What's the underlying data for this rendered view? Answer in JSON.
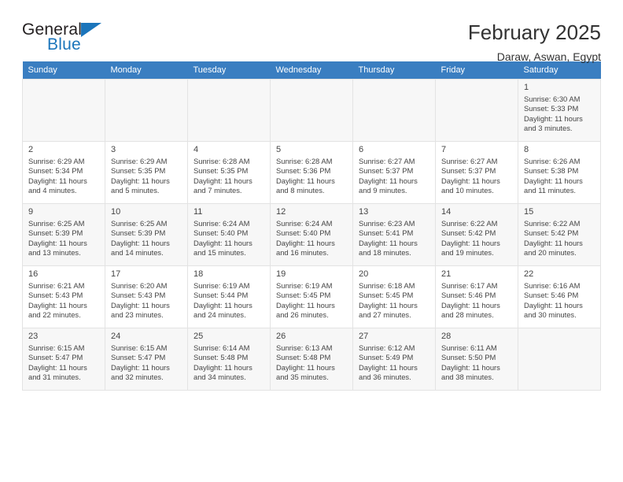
{
  "brand": {
    "name_top": "General",
    "name_bottom": "Blue",
    "accent_color": "#1b75bb"
  },
  "header": {
    "title": "February 2025",
    "subtitle": "Daraw, Aswan, Egypt"
  },
  "calendar": {
    "header_bg": "#3a7ec1",
    "weekdays": [
      "Sunday",
      "Monday",
      "Tuesday",
      "Wednesday",
      "Thursday",
      "Friday",
      "Saturday"
    ],
    "weeks": [
      [
        {
          "day": "",
          "sunrise": "",
          "sunset": "",
          "daylight_line1": "",
          "daylight_line2": "",
          "empty": true
        },
        {
          "day": "",
          "sunrise": "",
          "sunset": "",
          "daylight_line1": "",
          "daylight_line2": "",
          "empty": true
        },
        {
          "day": "",
          "sunrise": "",
          "sunset": "",
          "daylight_line1": "",
          "daylight_line2": "",
          "empty": true
        },
        {
          "day": "",
          "sunrise": "",
          "sunset": "",
          "daylight_line1": "",
          "daylight_line2": "",
          "empty": true
        },
        {
          "day": "",
          "sunrise": "",
          "sunset": "",
          "daylight_line1": "",
          "daylight_line2": "",
          "empty": true
        },
        {
          "day": "",
          "sunrise": "",
          "sunset": "",
          "daylight_line1": "",
          "daylight_line2": "",
          "empty": true
        },
        {
          "day": "1",
          "sunrise": "Sunrise: 6:30 AM",
          "sunset": "Sunset: 5:33 PM",
          "daylight_line1": "Daylight: 11 hours",
          "daylight_line2": "and 3 minutes."
        }
      ],
      [
        {
          "day": "2",
          "sunrise": "Sunrise: 6:29 AM",
          "sunset": "Sunset: 5:34 PM",
          "daylight_line1": "Daylight: 11 hours",
          "daylight_line2": "and 4 minutes."
        },
        {
          "day": "3",
          "sunrise": "Sunrise: 6:29 AM",
          "sunset": "Sunset: 5:35 PM",
          "daylight_line1": "Daylight: 11 hours",
          "daylight_line2": "and 5 minutes."
        },
        {
          "day": "4",
          "sunrise": "Sunrise: 6:28 AM",
          "sunset": "Sunset: 5:35 PM",
          "daylight_line1": "Daylight: 11 hours",
          "daylight_line2": "and 7 minutes."
        },
        {
          "day": "5",
          "sunrise": "Sunrise: 6:28 AM",
          "sunset": "Sunset: 5:36 PM",
          "daylight_line1": "Daylight: 11 hours",
          "daylight_line2": "and 8 minutes."
        },
        {
          "day": "6",
          "sunrise": "Sunrise: 6:27 AM",
          "sunset": "Sunset: 5:37 PM",
          "daylight_line1": "Daylight: 11 hours",
          "daylight_line2": "and 9 minutes."
        },
        {
          "day": "7",
          "sunrise": "Sunrise: 6:27 AM",
          "sunset": "Sunset: 5:37 PM",
          "daylight_line1": "Daylight: 11 hours",
          "daylight_line2": "and 10 minutes."
        },
        {
          "day": "8",
          "sunrise": "Sunrise: 6:26 AM",
          "sunset": "Sunset: 5:38 PM",
          "daylight_line1": "Daylight: 11 hours",
          "daylight_line2": "and 11 minutes."
        }
      ],
      [
        {
          "day": "9",
          "sunrise": "Sunrise: 6:25 AM",
          "sunset": "Sunset: 5:39 PM",
          "daylight_line1": "Daylight: 11 hours",
          "daylight_line2": "and 13 minutes."
        },
        {
          "day": "10",
          "sunrise": "Sunrise: 6:25 AM",
          "sunset": "Sunset: 5:39 PM",
          "daylight_line1": "Daylight: 11 hours",
          "daylight_line2": "and 14 minutes."
        },
        {
          "day": "11",
          "sunrise": "Sunrise: 6:24 AM",
          "sunset": "Sunset: 5:40 PM",
          "daylight_line1": "Daylight: 11 hours",
          "daylight_line2": "and 15 minutes."
        },
        {
          "day": "12",
          "sunrise": "Sunrise: 6:24 AM",
          "sunset": "Sunset: 5:40 PM",
          "daylight_line1": "Daylight: 11 hours",
          "daylight_line2": "and 16 minutes."
        },
        {
          "day": "13",
          "sunrise": "Sunrise: 6:23 AM",
          "sunset": "Sunset: 5:41 PM",
          "daylight_line1": "Daylight: 11 hours",
          "daylight_line2": "and 18 minutes."
        },
        {
          "day": "14",
          "sunrise": "Sunrise: 6:22 AM",
          "sunset": "Sunset: 5:42 PM",
          "daylight_line1": "Daylight: 11 hours",
          "daylight_line2": "and 19 minutes."
        },
        {
          "day": "15",
          "sunrise": "Sunrise: 6:22 AM",
          "sunset": "Sunset: 5:42 PM",
          "daylight_line1": "Daylight: 11 hours",
          "daylight_line2": "and 20 minutes."
        }
      ],
      [
        {
          "day": "16",
          "sunrise": "Sunrise: 6:21 AM",
          "sunset": "Sunset: 5:43 PM",
          "daylight_line1": "Daylight: 11 hours",
          "daylight_line2": "and 22 minutes."
        },
        {
          "day": "17",
          "sunrise": "Sunrise: 6:20 AM",
          "sunset": "Sunset: 5:43 PM",
          "daylight_line1": "Daylight: 11 hours",
          "daylight_line2": "and 23 minutes."
        },
        {
          "day": "18",
          "sunrise": "Sunrise: 6:19 AM",
          "sunset": "Sunset: 5:44 PM",
          "daylight_line1": "Daylight: 11 hours",
          "daylight_line2": "and 24 minutes."
        },
        {
          "day": "19",
          "sunrise": "Sunrise: 6:19 AM",
          "sunset": "Sunset: 5:45 PM",
          "daylight_line1": "Daylight: 11 hours",
          "daylight_line2": "and 26 minutes."
        },
        {
          "day": "20",
          "sunrise": "Sunrise: 6:18 AM",
          "sunset": "Sunset: 5:45 PM",
          "daylight_line1": "Daylight: 11 hours",
          "daylight_line2": "and 27 minutes."
        },
        {
          "day": "21",
          "sunrise": "Sunrise: 6:17 AM",
          "sunset": "Sunset: 5:46 PM",
          "daylight_line1": "Daylight: 11 hours",
          "daylight_line2": "and 28 minutes."
        },
        {
          "day": "22",
          "sunrise": "Sunrise: 6:16 AM",
          "sunset": "Sunset: 5:46 PM",
          "daylight_line1": "Daylight: 11 hours",
          "daylight_line2": "and 30 minutes."
        }
      ],
      [
        {
          "day": "23",
          "sunrise": "Sunrise: 6:15 AM",
          "sunset": "Sunset: 5:47 PM",
          "daylight_line1": "Daylight: 11 hours",
          "daylight_line2": "and 31 minutes."
        },
        {
          "day": "24",
          "sunrise": "Sunrise: 6:15 AM",
          "sunset": "Sunset: 5:47 PM",
          "daylight_line1": "Daylight: 11 hours",
          "daylight_line2": "and 32 minutes."
        },
        {
          "day": "25",
          "sunrise": "Sunrise: 6:14 AM",
          "sunset": "Sunset: 5:48 PM",
          "daylight_line1": "Daylight: 11 hours",
          "daylight_line2": "and 34 minutes."
        },
        {
          "day": "26",
          "sunrise": "Sunrise: 6:13 AM",
          "sunset": "Sunset: 5:48 PM",
          "daylight_line1": "Daylight: 11 hours",
          "daylight_line2": "and 35 minutes."
        },
        {
          "day": "27",
          "sunrise": "Sunrise: 6:12 AM",
          "sunset": "Sunset: 5:49 PM",
          "daylight_line1": "Daylight: 11 hours",
          "daylight_line2": "and 36 minutes."
        },
        {
          "day": "28",
          "sunrise": "Sunrise: 6:11 AM",
          "sunset": "Sunset: 5:50 PM",
          "daylight_line1": "Daylight: 11 hours",
          "daylight_line2": "and 38 minutes."
        },
        {
          "day": "",
          "sunrise": "",
          "sunset": "",
          "daylight_line1": "",
          "daylight_line2": "",
          "empty": true
        }
      ]
    ]
  }
}
